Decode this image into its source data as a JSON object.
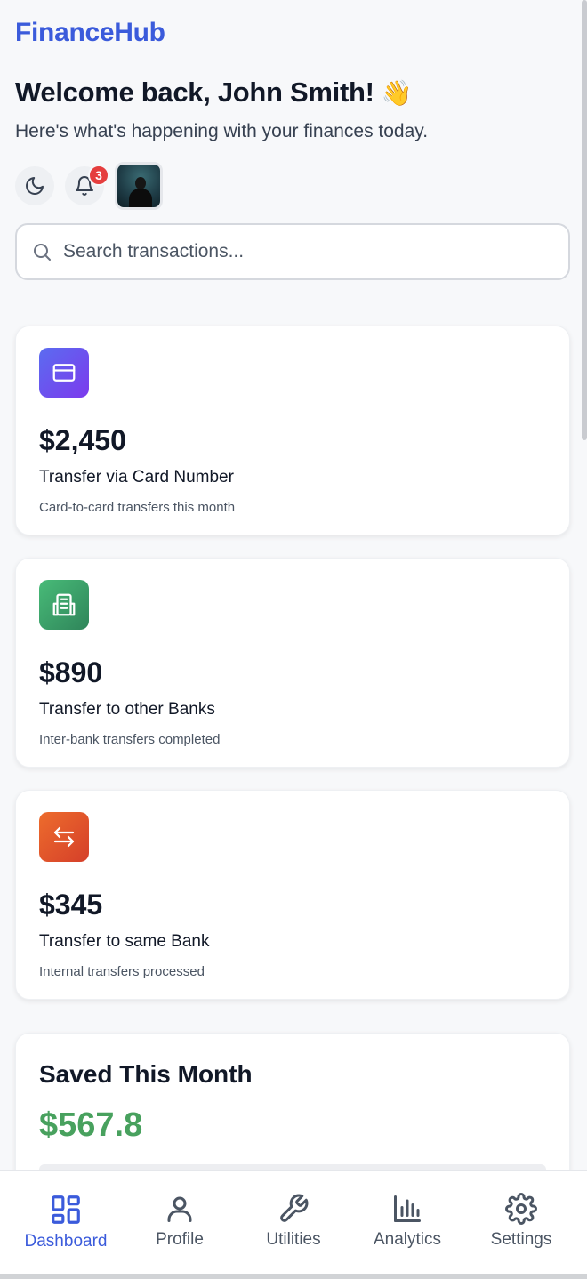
{
  "app": {
    "title": "FinanceHub"
  },
  "header": {
    "welcome": "Welcome back, John Smith!",
    "wave_emoji": "👋",
    "subtitle": "Here's what's happening with your finances today.",
    "notification_count": "3"
  },
  "search": {
    "placeholder": "Search transactions...",
    "value": ""
  },
  "cards": [
    {
      "amount": "$2,450",
      "title": "Transfer via Card Number",
      "description": "Card-to-card transfers this month",
      "icon": "credit-card-icon",
      "color": "#6d4cf0"
    },
    {
      "amount": "$890",
      "title": "Transfer to other Banks",
      "description": "Inter-bank transfers completed",
      "icon": "building-icon",
      "color": "#48a15e"
    },
    {
      "amount": "$345",
      "title": "Transfer to same Bank",
      "description": "Internal transfers processed",
      "icon": "transfer-arrows-icon",
      "color": "#e05a2a"
    }
  ],
  "saved": {
    "title": "Saved This Month",
    "amount": "$567.8",
    "color": "#48a15e"
  },
  "nav": {
    "items": [
      {
        "label": "Dashboard",
        "icon": "dashboard-grid-icon",
        "active": true
      },
      {
        "label": "Profile",
        "icon": "user-icon",
        "active": false
      },
      {
        "label": "Utilities",
        "icon": "wrench-icon",
        "active": false
      },
      {
        "label": "Analytics",
        "icon": "bar-chart-icon",
        "active": false
      },
      {
        "label": "Settings",
        "icon": "gear-icon",
        "active": false
      }
    ]
  },
  "colors": {
    "brand": "#3b5bdb",
    "badge": "#e53e3e"
  }
}
